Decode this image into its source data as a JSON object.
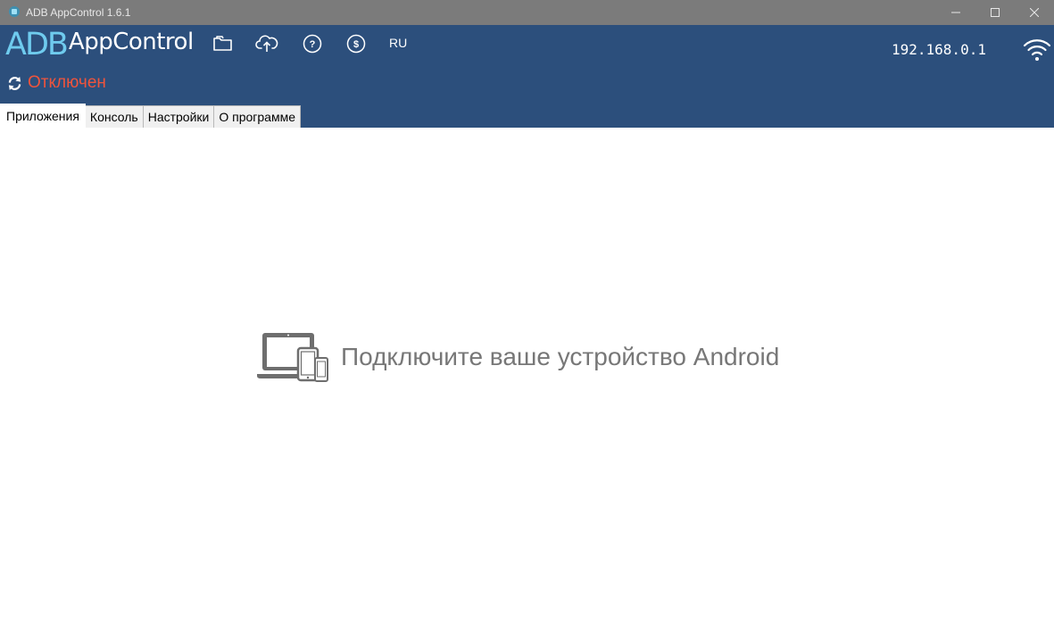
{
  "window": {
    "title": "ADB AppControl 1.6.1",
    "icon": "adb-app-icon",
    "controls": [
      "minimize-icon",
      "maximize-icon",
      "close-icon"
    ]
  },
  "header": {
    "logo_adb": "ADB",
    "logo_app": "AppControl",
    "toolbar_icons": [
      "folder-icon",
      "cloud-upload-icon",
      "help-icon",
      "donate-icon"
    ],
    "language": "RU",
    "ip_address": "192.168.0.1",
    "wifi_icon": "wifi-icon"
  },
  "status": {
    "icon": "refresh-icon",
    "text": "Отключен",
    "color": "#f0543c"
  },
  "tabs": [
    {
      "label": "Приложения",
      "active": true
    },
    {
      "label": "Консоль",
      "active": false
    },
    {
      "label": "Настройки",
      "active": false
    },
    {
      "label": "О программе",
      "active": false
    }
  ],
  "main": {
    "icon": "devices-icon",
    "message": "Подключите ваше устройство Android"
  },
  "colors": {
    "titlebar": "#7b7b7b",
    "header": "#2c4f7c",
    "logo_accent": "#6fcbee",
    "message": "#777777"
  }
}
